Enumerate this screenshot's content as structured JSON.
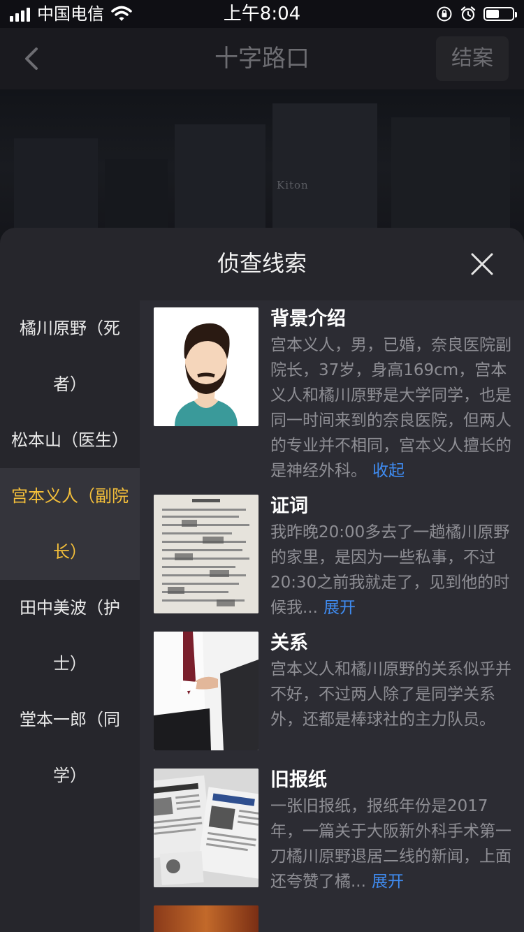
{
  "status_bar": {
    "carrier": "中国电信",
    "time": "上午8:04"
  },
  "nav": {
    "title": "十字路口",
    "close_case": "结案"
  },
  "scene": {
    "sign_text": "Kiton"
  },
  "sheet": {
    "title": "侦查线索"
  },
  "sidebar": {
    "items": [
      {
        "label": "橘川原野（死者）",
        "active": false
      },
      {
        "label": "松本山（医生）",
        "active": false
      },
      {
        "label": "宫本义人（副院长）",
        "active": true
      },
      {
        "label": "田中美波（护士）",
        "active": false
      },
      {
        "label": "堂本一郎（同学）",
        "active": false
      }
    ]
  },
  "clues": [
    {
      "title": "背景介绍",
      "body": "宫本义人，男，已婚，奈良医院副院长，37岁，身高169cm，宫本义人和橘川原野是大学同学，也是同一时间来到的奈良医院，但两人的专业并不相同，宫本义人擅长的是神经外科。",
      "link": "收起"
    },
    {
      "title": "证词",
      "body": "我昨晚20:00多去了一趟橘川原野的家里，是因为一些私事，不过20:30之前我就走了，见到他的时候我...",
      "link": "展开"
    },
    {
      "title": "关系",
      "body": "宫本义人和橘川原野的关系似乎并不好，不过两人除了是同学关系外，还都是棒球社的主力队员。",
      "link": ""
    },
    {
      "title": "旧报纸",
      "body": "一张旧报纸，报纸年份是2017年，一篇关于大阪新外科手术第一刀橘川原野退居二线的新闻，上面还夸赞了橘...",
      "link": "展开"
    }
  ],
  "colors": {
    "accent_active": "#f4bf3a",
    "link": "#3f8cf2"
  }
}
